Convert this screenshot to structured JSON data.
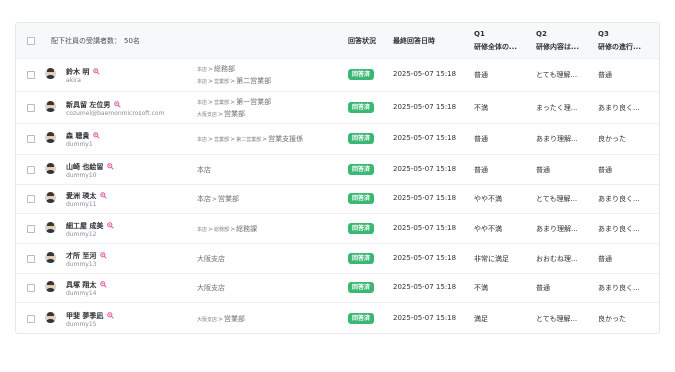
{
  "header": {
    "subordinate_count_label": "配下社員の受講者数：",
    "subordinate_count_value": "50名",
    "status_label": "回答状況",
    "last_answer_label": "最終回答日時",
    "questions": [
      {
        "code": "Q1",
        "title": "研修全体の..."
      },
      {
        "code": "Q2",
        "title": "研修内容は..."
      },
      {
        "code": "Q3",
        "title": "研修の進行..."
      }
    ]
  },
  "rows": [
    {
      "name": "鈴木 明",
      "id": "akira",
      "org": [
        [
          {
            "t": "本店",
            "s": "small"
          },
          {
            "t": ">",
            "s": "sep"
          },
          {
            "t": "総務部",
            "s": "big"
          }
        ],
        [
          {
            "t": "本店",
            "s": "small"
          },
          {
            "t": ">",
            "s": "sep"
          },
          {
            "t": "営業部",
            "s": "small"
          },
          {
            "t": ">",
            "s": "sep"
          },
          {
            "t": "第二営業部",
            "s": "big"
          }
        ]
      ],
      "status": "回答済",
      "datetime": "2025-05-07 15:18",
      "q1": "普通",
      "q2": "とても理解...",
      "q3": "普通"
    },
    {
      "name": "新具留 左位男",
      "id": "cozumel@baemonmicrosoft.com",
      "org": [
        [
          {
            "t": "本店",
            "s": "small"
          },
          {
            "t": ">",
            "s": "sep"
          },
          {
            "t": "営業部",
            "s": "small"
          },
          {
            "t": ">",
            "s": "sep"
          },
          {
            "t": "第一営業部",
            "s": "big"
          }
        ],
        [
          {
            "t": "大阪支店",
            "s": "small"
          },
          {
            "t": ">",
            "s": "sep"
          },
          {
            "t": "営業部",
            "s": "big"
          }
        ]
      ],
      "status": "回答済",
      "datetime": "2025-05-07 15:18",
      "q1": "不満",
      "q2": "まったく理...",
      "q3": "あまり良く..."
    },
    {
      "name": "森 聰貴",
      "id": "dummy1",
      "org": [
        [
          {
            "t": "本店",
            "s": "small"
          },
          {
            "t": ">",
            "s": "sep"
          },
          {
            "t": "営業部",
            "s": "small"
          },
          {
            "t": ">",
            "s": "sep"
          },
          {
            "t": "第二営業部",
            "s": "small"
          },
          {
            "t": ">",
            "s": "sep"
          },
          {
            "t": "営業支援係",
            "s": "big"
          }
        ]
      ],
      "status": "回答済",
      "datetime": "2025-05-07 15:18",
      "q1": "普通",
      "q2": "あまり理解...",
      "q3": "良かった"
    },
    {
      "name": "山崎 也絵留",
      "id": "dummy10",
      "org": [
        [
          {
            "t": "本店",
            "s": "big"
          }
        ]
      ],
      "status": "回答済",
      "datetime": "2025-05-07 15:18",
      "q1": "普通",
      "q2": "普通",
      "q3": "普通"
    },
    {
      "name": "愛洲 瑛太",
      "id": "dummy11",
      "org": [
        [
          {
            "t": "本店",
            "s": "big"
          },
          {
            "t": ">",
            "s": "sep"
          },
          {
            "t": "営業部",
            "s": "big"
          }
        ]
      ],
      "status": "回答済",
      "datetime": "2025-05-07 15:18",
      "q1": "やや不満",
      "q2": "とても理解...",
      "q3": "あまり良く..."
    },
    {
      "name": "細工屋 成美",
      "id": "dummy12",
      "org": [
        [
          {
            "t": "本店",
            "s": "small"
          },
          {
            "t": ">",
            "s": "sep"
          },
          {
            "t": "総務部",
            "s": "small"
          },
          {
            "t": ">",
            "s": "sep"
          },
          {
            "t": "総務課",
            "s": "big"
          }
        ]
      ],
      "status": "回答済",
      "datetime": "2025-05-07 15:18",
      "q1": "やや不満",
      "q2": "あまり理解...",
      "q3": "あまり良く..."
    },
    {
      "name": "才所 至河",
      "id": "dummy13",
      "org": [
        [
          {
            "t": "大阪支店",
            "s": "big"
          }
        ]
      ],
      "status": "回答済",
      "datetime": "2025-05-07 15:18",
      "q1": "非常に満足",
      "q2": "おおむね理...",
      "q3": "普通"
    },
    {
      "name": "具塚 翔太",
      "id": "dummy14",
      "org": [
        [
          {
            "t": "大阪支店",
            "s": "big"
          }
        ]
      ],
      "status": "回答済",
      "datetime": "2025-05-07 15:18",
      "q1": "不満",
      "q2": "普通",
      "q3": "あまり良く..."
    },
    {
      "name": "甲斐 夢季凪",
      "id": "dummy15",
      "org": [
        [
          {
            "t": "大阪支店",
            "s": "small"
          },
          {
            "t": ">",
            "s": "sep"
          },
          {
            "t": "営業部",
            "s": "big"
          }
        ]
      ],
      "status": "回答済",
      "datetime": "2025-05-07 15:18",
      "q1": "満足",
      "q2": "とても理解...",
      "q3": "良かった"
    }
  ]
}
